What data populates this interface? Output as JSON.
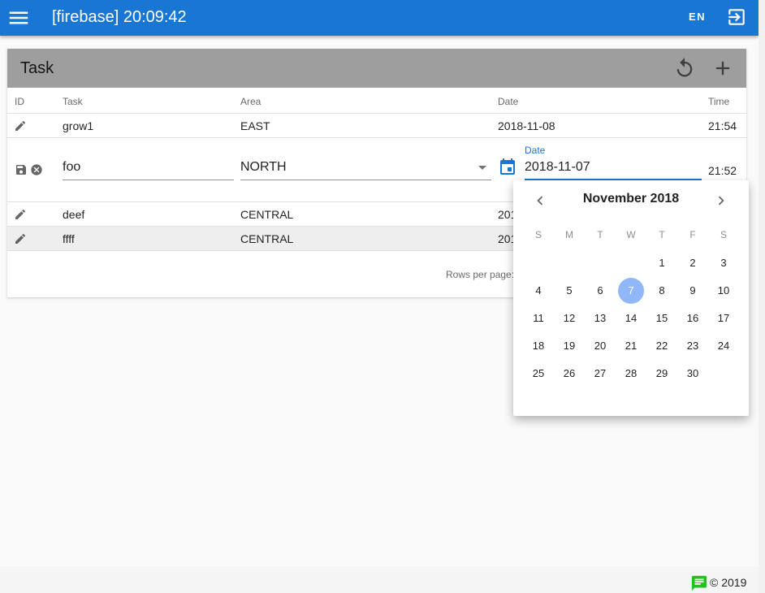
{
  "appbar": {
    "title": "[firebase] 20:09:42",
    "lang": "EN"
  },
  "card": {
    "title": "Task"
  },
  "columns": {
    "id": "ID",
    "task": "Task",
    "area": "Area",
    "date": "Date",
    "time": "Time"
  },
  "rows": [
    {
      "task": "grow1",
      "area": "EAST",
      "date": "2018-11-08",
      "time": "21:54"
    },
    {
      "task": "deef",
      "area": "CENTRAL",
      "date": "201",
      "time": ""
    },
    {
      "task": "ffff",
      "area": "CENTRAL",
      "date": "201",
      "time": ""
    }
  ],
  "edit_row": {
    "task_value": "foo",
    "area_value": "NORTH",
    "date_label": "Date",
    "date_value": "2018-11-07",
    "time": "21:52"
  },
  "pagination": {
    "rows_per_page": "Rows per page:"
  },
  "picker": {
    "month_label": "November 2018",
    "weekdays": [
      "S",
      "M",
      "T",
      "W",
      "T",
      "F",
      "S"
    ],
    "days": [
      "1",
      "2",
      "3",
      "4",
      "5",
      "6",
      "7",
      "8",
      "9",
      "10",
      "11",
      "12",
      "13",
      "14",
      "15",
      "16",
      "17",
      "18",
      "19",
      "20",
      "21",
      "22",
      "23",
      "24",
      "25",
      "26",
      "27",
      "28",
      "29",
      "30"
    ],
    "first_weekday_index": 4,
    "selected_day": "7"
  },
  "footer": {
    "copyright": "© 2019"
  },
  "colors": {
    "primary": "#1976d2",
    "header_gray": "#9e9e9e",
    "selected_day": "#90b8f8",
    "chat_icon": "#22c222"
  },
  "icons": {
    "menu": "menu-icon",
    "logout": "logout-icon",
    "refresh": "refresh-icon",
    "add": "add-icon",
    "edit": "pencil-icon",
    "save": "save-icon",
    "cancel": "cancel-icon",
    "calendar": "calendar-icon",
    "chat": "chat-icon"
  }
}
